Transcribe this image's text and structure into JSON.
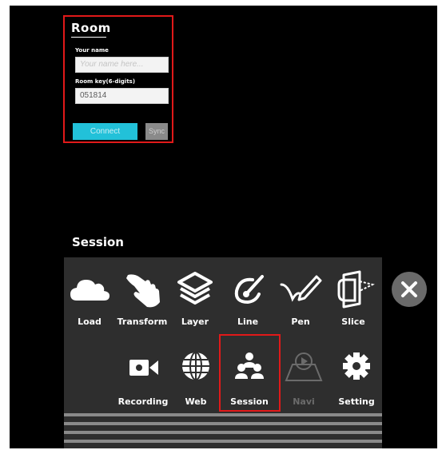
{
  "room": {
    "title": "Room",
    "name_label": "Your name",
    "name_placeholder": "Your name here...",
    "key_label": "Room key(6-digits)",
    "key_value": "051814",
    "connect_label": "Connect",
    "sync_label": "Sync"
  },
  "menu": {
    "section_title": "Session",
    "tools": [
      {
        "label": "Load",
        "icon": "cloud-icon"
      },
      {
        "label": "Transform",
        "icon": "hand-icon"
      },
      {
        "label": "Layer",
        "icon": "layers-icon"
      },
      {
        "label": "Line",
        "icon": "line-icon"
      },
      {
        "label": "Pen",
        "icon": "pen-icon"
      },
      {
        "label": "Slice",
        "icon": "slice-icon"
      },
      {
        "label": "Recording",
        "icon": "video-camera-icon"
      },
      {
        "label": "Web",
        "icon": "globe-icon"
      },
      {
        "label": "Session",
        "icon": "users-icon"
      },
      {
        "label": "Navi",
        "icon": "navi-icon"
      },
      {
        "label": "Setting",
        "icon": "gear-icon"
      }
    ],
    "close_icon": "close-icon"
  },
  "colors": {
    "highlight": "#e11919",
    "connect": "#22c1d9",
    "panel": "#2e2e2e"
  }
}
